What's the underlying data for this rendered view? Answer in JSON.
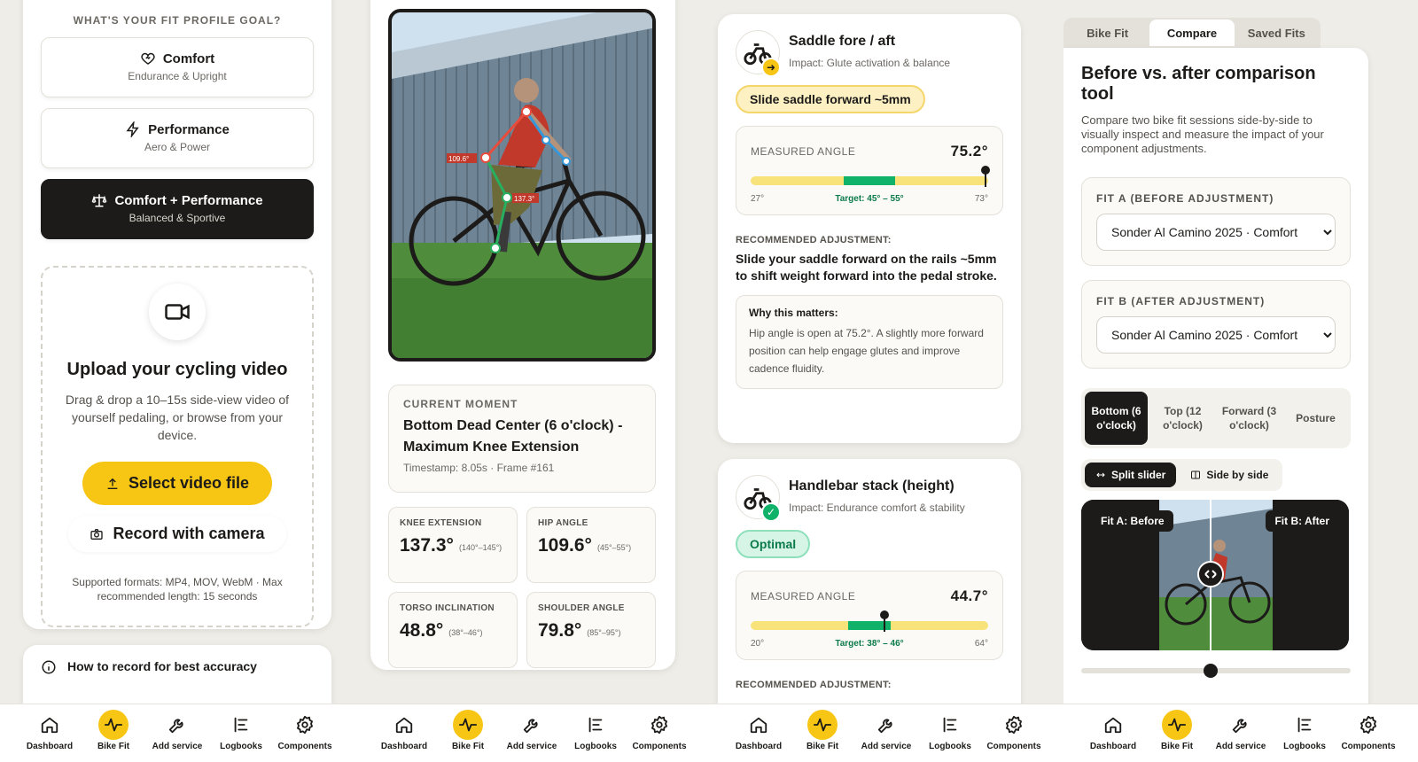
{
  "panel1": {
    "goal_title": "WHAT'S YOUR FIT PROFILE GOAL?",
    "goals": [
      {
        "title": "Comfort",
        "sub": "Endurance & Upright",
        "icon": "heart-icon"
      },
      {
        "title": "Performance",
        "sub": "Aero & Power",
        "icon": "lightning-icon"
      },
      {
        "title": "Comfort + Performance",
        "sub": "Balanced & Sportive",
        "icon": "balance-icon",
        "selected": true
      }
    ],
    "upload_title": "Upload your cycling video",
    "upload_desc": "Drag & drop a 10–15s side-view video of yourself pedaling, or browse from your device.",
    "select_button": "Select video file",
    "camera_button": "Record with camera",
    "formats_note": "Supported formats: MP4, MOV, WebM · Max recommended length: 15 seconds",
    "howto_title": "How to record for best accuracy"
  },
  "panel2": {
    "overlay_labels": {
      "hip": "109.6°",
      "knee": "137.3°"
    },
    "moment_label": "CURRENT MOMENT",
    "moment_title": "Bottom Dead Center (6 o'clock) - Maximum Knee Extension",
    "moment_ts": "Timestamp: 8.05s · Frame #161",
    "metrics": [
      {
        "label": "KNEE EXTENSION",
        "value": "137.3°",
        "range": "(140°–145°)"
      },
      {
        "label": "HIP ANGLE",
        "value": "109.6°",
        "range": "(45°–55°)"
      },
      {
        "label": "TORSO INCLINATION",
        "value": "48.8°",
        "range": "(38°–46°)"
      },
      {
        "label": "SHOULDER ANGLE",
        "value": "79.8°",
        "range": "(85°–95°)"
      }
    ]
  },
  "panel3": {
    "saddle": {
      "title": "Saddle fore / aft",
      "impact": "Impact: Glute activation & balance",
      "pill": "Slide saddle forward ~5mm",
      "measured_label": "MEASURED ANGLE",
      "measured_value": "75.2°",
      "scale_min": "27°",
      "scale_max": "73°",
      "target": "Target: 45° – 55°",
      "zone_start": 0.39,
      "zone_end": 0.61,
      "marker": 0.985,
      "rec_label": "RECOMMENDED ADJUSTMENT:",
      "rec_text": "Slide your saddle forward on the rails ~5mm to shift weight forward into the pedal stroke.",
      "why_title": "Why this matters:",
      "why_text": "Hip angle is open at 75.2°. A slightly more forward position can help engage glutes and improve cadence fluidity."
    },
    "handlebar": {
      "title": "Handlebar stack (height)",
      "impact": "Impact: Endurance comfort & stability",
      "pill": "Optimal",
      "measured_label": "MEASURED ANGLE",
      "measured_value": "44.7°",
      "scale_min": "20°",
      "scale_max": "64°",
      "target": "Target: 38° – 46°",
      "zone_start": 0.41,
      "zone_end": 0.59,
      "marker": 0.56,
      "rec_label": "RECOMMENDED ADJUSTMENT:"
    }
  },
  "panel4": {
    "tabs": [
      "Bike Fit",
      "Compare",
      "Saved Fits"
    ],
    "active_tab": 1,
    "title": "Before vs. after comparison tool",
    "desc": "Compare two bike fit sessions side-by-side to visually inspect and measure the impact of your component adjustments.",
    "fit_a_label": "FIT A (BEFORE ADJUSTMENT)",
    "fit_a_value": "Sonder Al Camino 2025 · Comfort",
    "fit_b_label": "FIT B (AFTER ADJUSTMENT)",
    "fit_b_value": "Sonder Al Camino 2025 · Comfort",
    "phases": [
      "Bottom (6 o'clock)",
      "Top (12 o'clock)",
      "Forward (3 o'clock)",
      "Posture"
    ],
    "modes": [
      "Split slider",
      "Side by side"
    ],
    "fit_a_tag": "Fit A: Before",
    "fit_b_tag": "Fit B: After",
    "slider_value": 0.48
  },
  "nav": [
    {
      "label": "Dashboard",
      "icon": "home-icon"
    },
    {
      "label": "Bike Fit",
      "icon": "pulse-icon",
      "active": true
    },
    {
      "label": "Add service",
      "icon": "wrench-icon"
    },
    {
      "label": "Logbooks",
      "icon": "list-icon"
    },
    {
      "label": "Components",
      "icon": "gear-icon"
    }
  ],
  "colors": {
    "accent": "#f7c514",
    "dark": "#1c1b19",
    "green": "#10b26a",
    "bg": "#efede7"
  }
}
